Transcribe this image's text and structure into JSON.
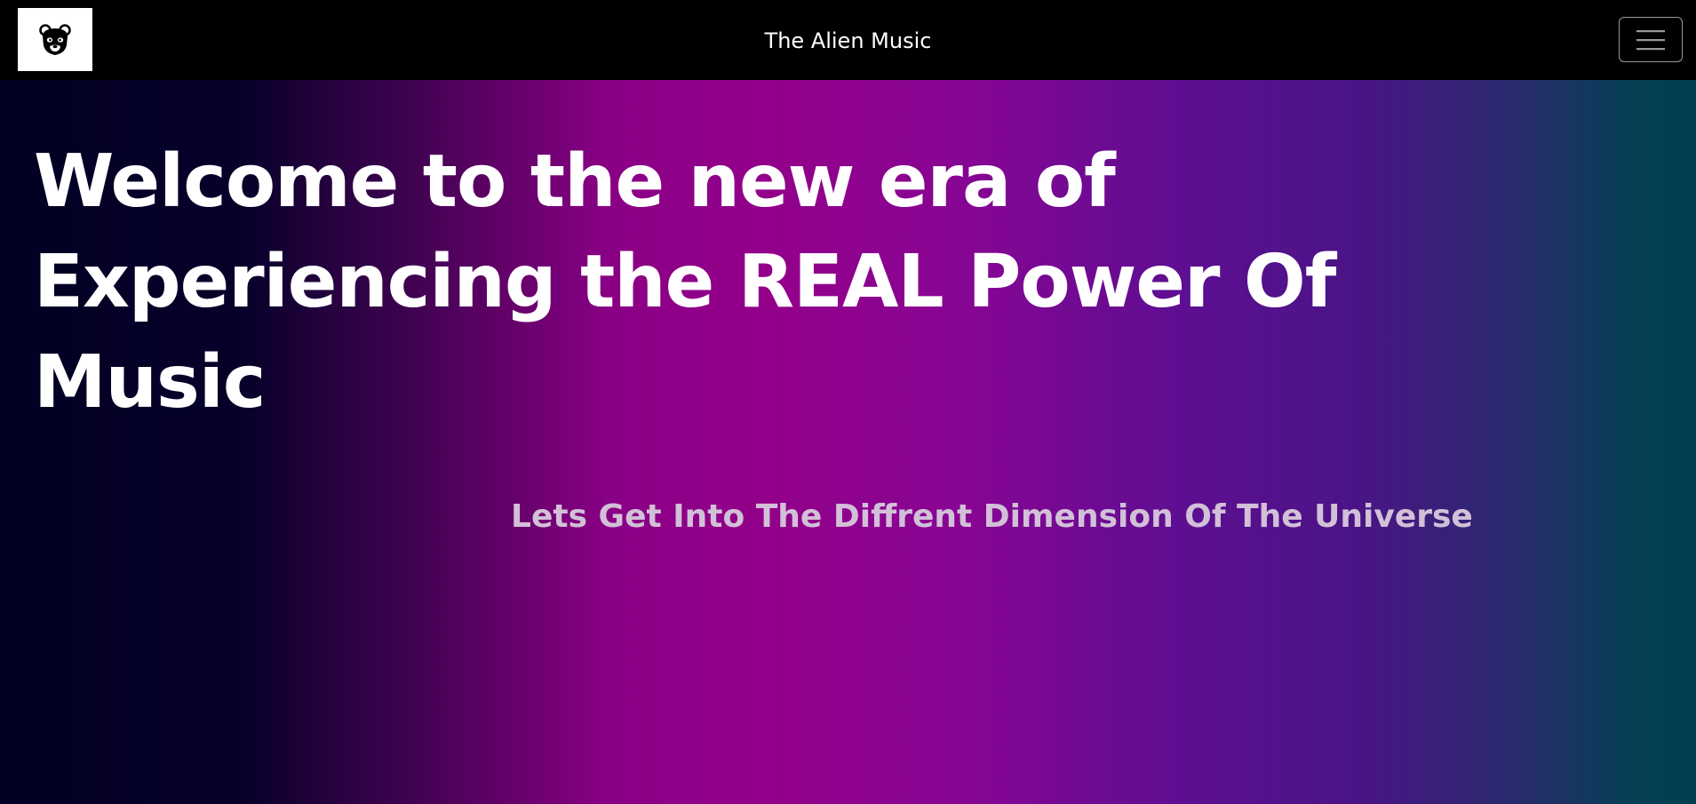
{
  "navbar": {
    "logo_icon": "bear-face-icon",
    "title": "The Alien Music",
    "menu_icon": "hamburger-menu-icon"
  },
  "hero": {
    "heading": "Welcome to the new era of Experiencing the REAL Power Of Music",
    "subheading": "Lets Get Into The Diffrent Dimension Of The Universe"
  },
  "colors": {
    "navbar_bg": "#000000",
    "text_primary": "#ffffff",
    "text_secondary": "#d2c0d8",
    "gradient_start": "#020024",
    "gradient_mid": "#93008a",
    "gradient_end": "#003e4f"
  }
}
